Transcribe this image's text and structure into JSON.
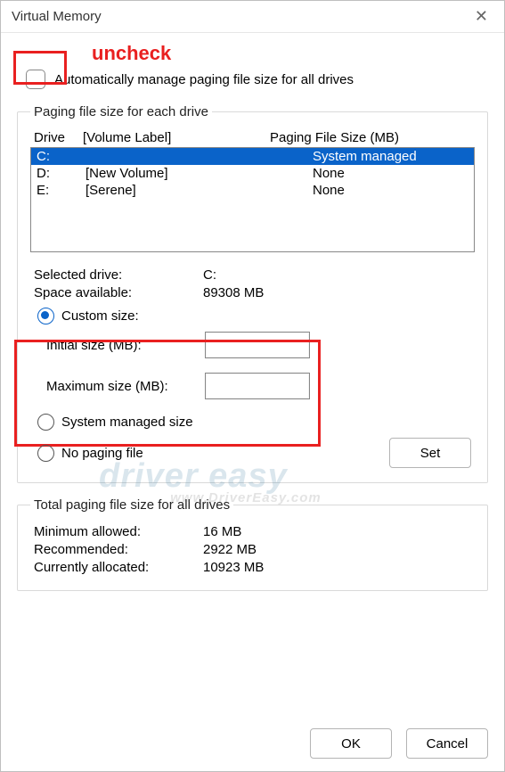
{
  "title": "Virtual Memory",
  "annot_uncheck": "uncheck",
  "auto_label": "Automatically manage paging file size for all drives",
  "group1": {
    "legend": "Paging file size for each drive",
    "head_drive": "Drive",
    "head_vol": "[Volume Label]",
    "head_size": "Paging File Size (MB)",
    "rows": [
      {
        "drive": "C:",
        "vol": "",
        "size": "System managed",
        "selected": true
      },
      {
        "drive": "D:",
        "vol": "[New Volume]",
        "size": "None",
        "selected": false
      },
      {
        "drive": "E:",
        "vol": "[Serene]",
        "size": "None",
        "selected": false
      }
    ],
    "selected_drive_label": "Selected drive:",
    "selected_drive_value": "C:",
    "space_label": "Space available:",
    "space_value": "89308 MB",
    "opt_custom": "Custom size:",
    "initial_label": "Initial size (MB):",
    "initial_value": "",
    "max_label": "Maximum size (MB):",
    "max_value": "",
    "opt_sysmanaged": "System managed size",
    "opt_nopf": "No paging file",
    "set_label": "Set"
  },
  "group2": {
    "legend": "Total paging file size for all drives",
    "min_label": "Minimum allowed:",
    "min_value": "16 MB",
    "rec_label": "Recommended:",
    "rec_value": "2922 MB",
    "cur_label": "Currently allocated:",
    "cur_value": "10923 MB"
  },
  "ok_label": "OK",
  "cancel_label": "Cancel",
  "watermark_main": "driver easy",
  "watermark_sub": "www.DriverEasy.com"
}
